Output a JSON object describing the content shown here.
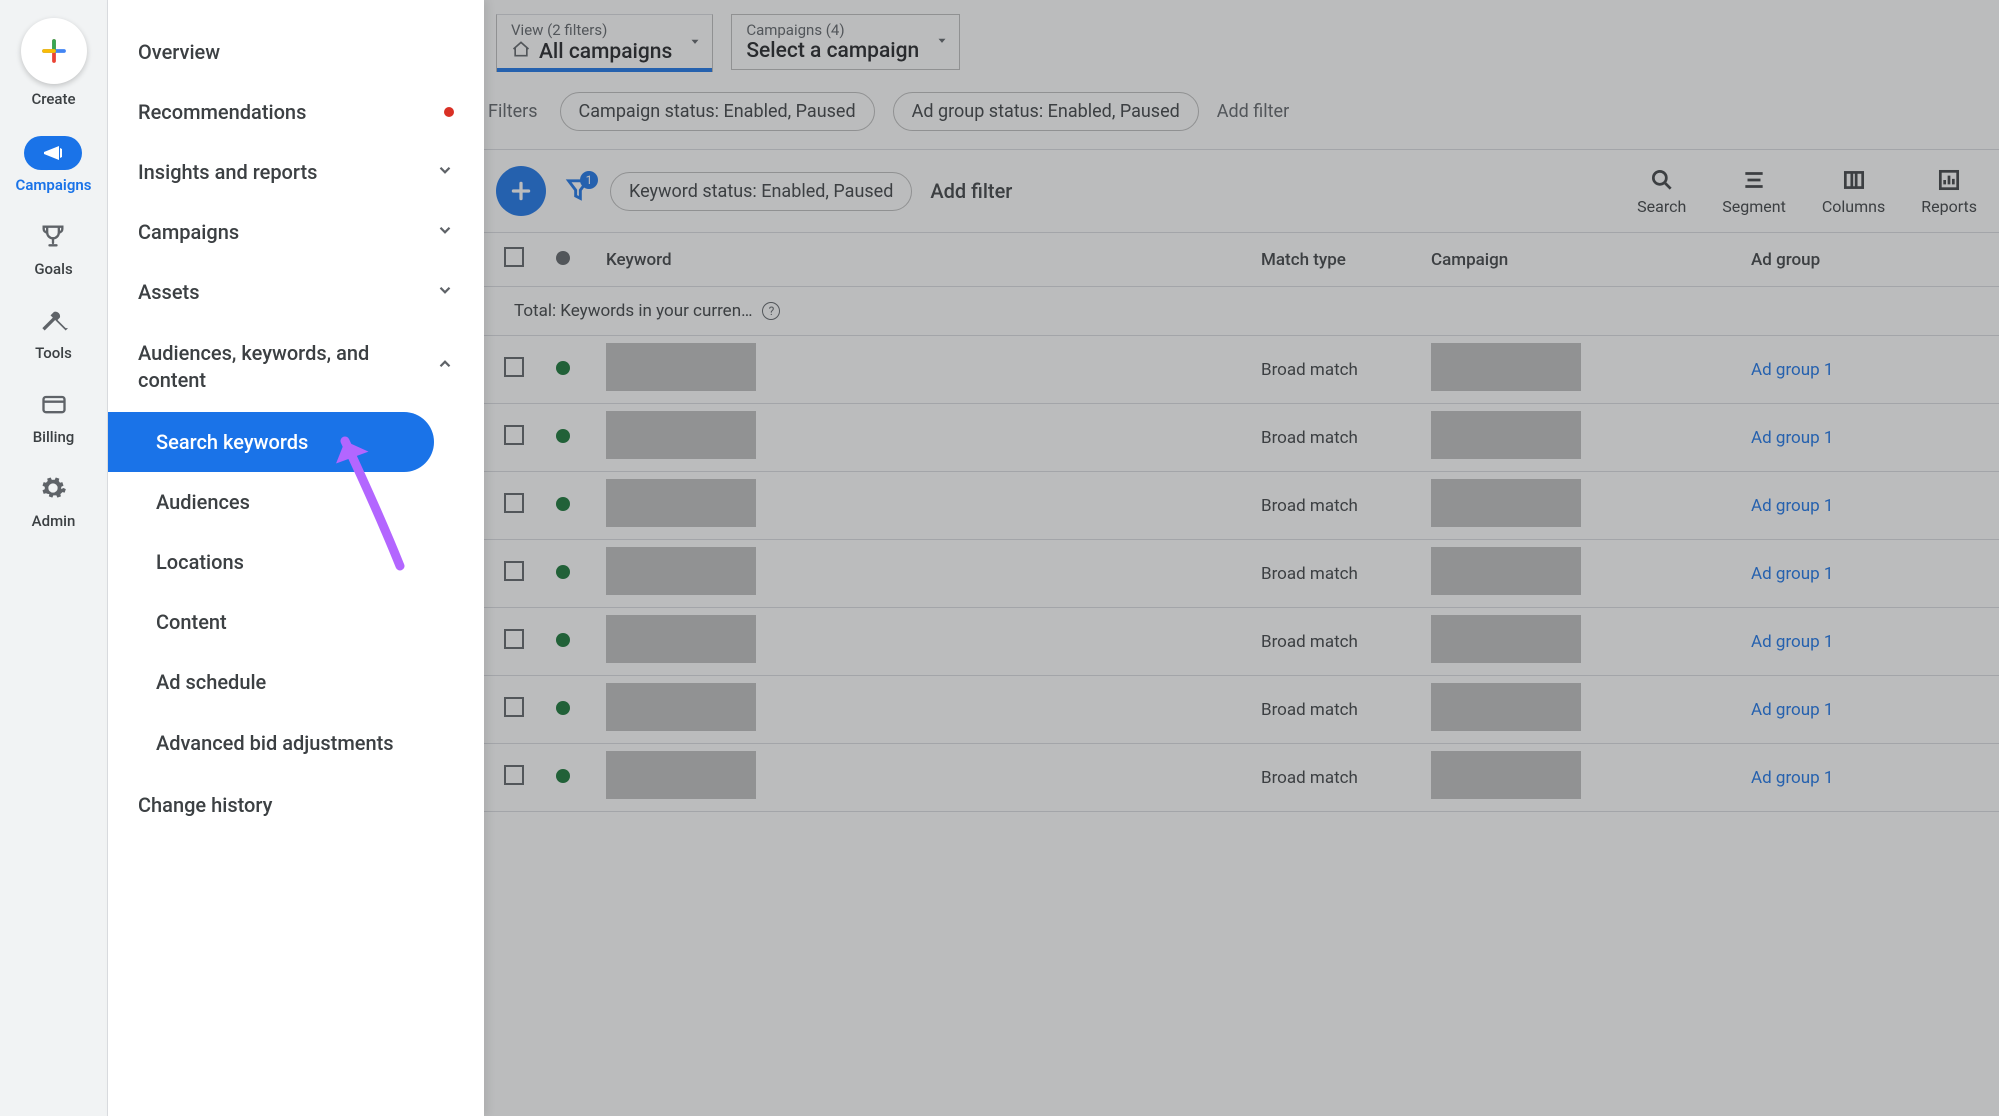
{
  "rail": {
    "create": "Create",
    "campaigns": "Campaigns",
    "goals": "Goals",
    "tools": "Tools",
    "billing": "Billing",
    "admin": "Admin"
  },
  "nav": {
    "overview": "Overview",
    "recommendations": "Recommendations",
    "insights": "Insights and reports",
    "campaigns": "Campaigns",
    "assets": "Assets",
    "akc": "Audiences, keywords, and content",
    "akc_items": {
      "search_keywords": "Search keywords",
      "audiences": "Audiences",
      "locations": "Locations",
      "content": "Content",
      "ad_schedule": "Ad schedule",
      "advanced_bid": "Advanced bid adjustments"
    },
    "change_history": "Change history"
  },
  "pickers": {
    "view_small": "View (2 filters)",
    "view_big": "All campaigns",
    "camp_small": "Campaigns (4)",
    "camp_big": "Select a campaign"
  },
  "top_filters": {
    "label": "Filters",
    "chip1": "Campaign status: Enabled, Paused",
    "chip2": "Ad group status: Enabled, Paused",
    "add": "Add filter"
  },
  "toolbar": {
    "filter_badge": "1",
    "chip": "Keyword status: Enabled, Paused",
    "add": "Add filter",
    "search": "Search",
    "segment": "Segment",
    "columns": "Columns",
    "reports": "Reports"
  },
  "table": {
    "headers": {
      "keyword": "Keyword",
      "match_type": "Match type",
      "campaign": "Campaign",
      "ad_group": "Ad group"
    },
    "total_row": "Total: Keywords in your curren…",
    "rows": [
      {
        "match_type": "Broad match",
        "ad_group": "Ad group 1"
      },
      {
        "match_type": "Broad match",
        "ad_group": "Ad group 1"
      },
      {
        "match_type": "Broad match",
        "ad_group": "Ad group 1"
      },
      {
        "match_type": "Broad match",
        "ad_group": "Ad group 1"
      },
      {
        "match_type": "Broad match",
        "ad_group": "Ad group 1"
      },
      {
        "match_type": "Broad match",
        "ad_group": "Ad group 1"
      },
      {
        "match_type": "Broad match",
        "ad_group": "Ad group 1"
      }
    ]
  }
}
